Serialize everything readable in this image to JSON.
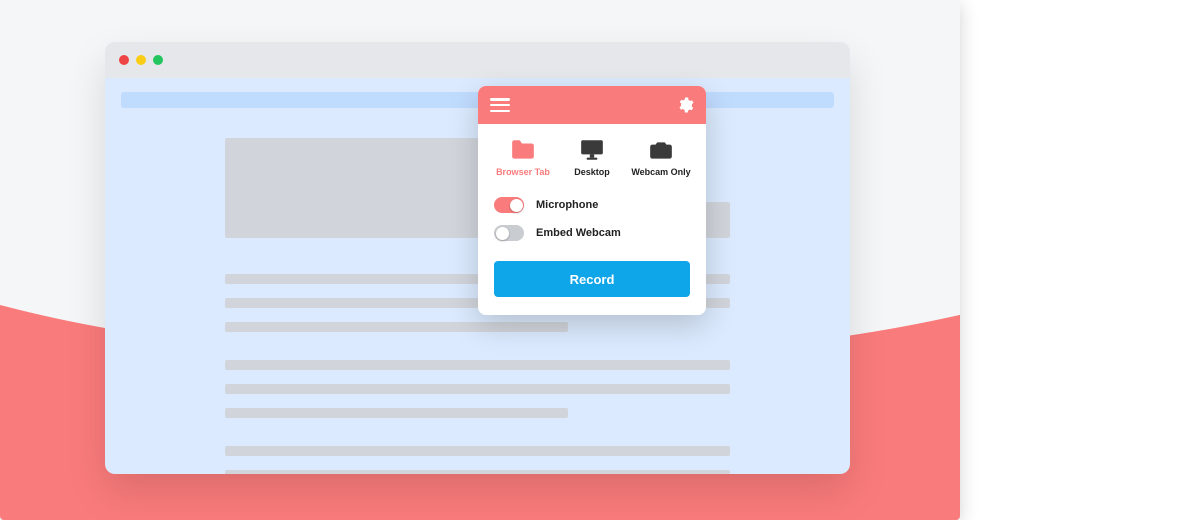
{
  "colors": {
    "accent": "#fa7b7b",
    "primary_button": "#0ea5e9",
    "toggle_on": "#fa7b7b",
    "toggle_off": "#c9ccd1",
    "icon_dark": "#3a3a3a"
  },
  "popup": {
    "header": {
      "menu_icon": "hamburger-icon",
      "settings_icon": "gear-icon"
    },
    "modes": [
      {
        "id": "browser-tab",
        "label": "Browser Tab",
        "icon": "folder-icon",
        "active": true
      },
      {
        "id": "desktop",
        "label": "Desktop",
        "icon": "monitor-icon",
        "active": false
      },
      {
        "id": "webcam-only",
        "label": "Webcam Only",
        "icon": "camera-icon",
        "active": false
      }
    ],
    "toggles": [
      {
        "id": "microphone",
        "label": "Microphone",
        "on": true
      },
      {
        "id": "embed-webcam",
        "label": "Embed Webcam",
        "on": false
      }
    ],
    "record_label": "Record"
  }
}
